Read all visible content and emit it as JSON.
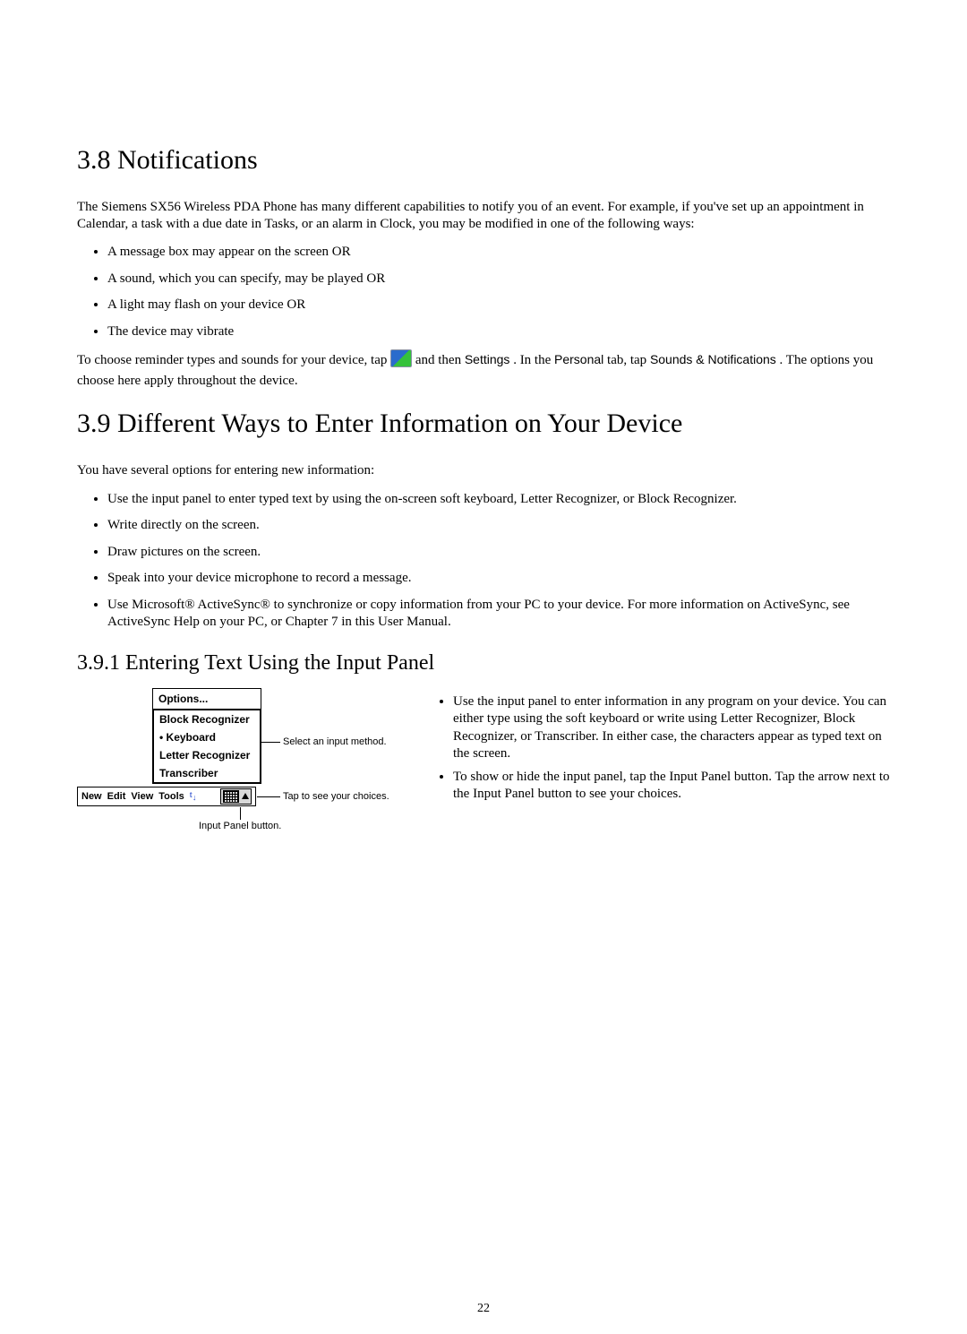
{
  "page_number": "22",
  "section38": {
    "heading": "3.8 Notifications",
    "para": "The Siemens SX56 Wireless PDA Phone has many different capabilities to notify you of an event. For example, if you've set up an appointment in Calendar, a task with a due date in Tasks, or an alarm in Clock, you may be modified in one of the following ways:",
    "bullets": [
      "A message box may appear on the screen OR",
      "A sound, which you can specify, may be played OR",
      "A light may flash on your device OR",
      "The device may vibrate"
    ],
    "settings_pre": "To choose reminder types and sounds for your device, tap ",
    "settings_mid1": " and then ",
    "settings_term1": "Settings",
    "settings_mid2": ". In the ",
    "settings_term2": "Personal",
    "settings_mid3": " tab, tap ",
    "settings_term3": "Sounds & Notifications",
    "settings_post": ". The options you choose here apply throughout the device."
  },
  "section39": {
    "heading": "3.9 Different Ways to Enter Information on Your Device",
    "para": "You have several options for entering new information:",
    "bullets": [
      "Use the input panel to enter typed text by using the on-screen soft keyboard, Letter Recognizer, or Block Recognizer.",
      "Write directly on the screen.",
      "Draw pictures on the screen.",
      "Speak into your device microphone to record a message.",
      "Use Microsoft® ActiveSync® to synchronize or copy information from your PC to your device. For more information on ActiveSync, see ActiveSync Help on your PC, or Chapter 7 in this User Manual."
    ]
  },
  "section391": {
    "heading": "3.9.1 Entering Text Using the Input Panel",
    "right_bullets": [
      "Use the input panel to enter information in any program on your device. You can either type using the soft keyboard or write using Letter Recognizer, Block Recognizer, or Transcriber. In either case, the characters appear as typed text on the screen.",
      "To show or hide the input panel, tap the Input Panel button. Tap the arrow next to the Input Panel button to see your choices."
    ],
    "figure": {
      "popup_options": "Options...",
      "methods": [
        "Block Recognizer",
        "Keyboard",
        "Letter Recognizer",
        "Transcriber"
      ],
      "selected_method_index": 1,
      "callout_select": "Select an input method.",
      "callout_tap": "Tap to see your choices.",
      "callout_button": "Input Panel button.",
      "menubar": {
        "new": "New",
        "edit": "Edit",
        "view": "View",
        "tools": "Tools"
      }
    }
  }
}
